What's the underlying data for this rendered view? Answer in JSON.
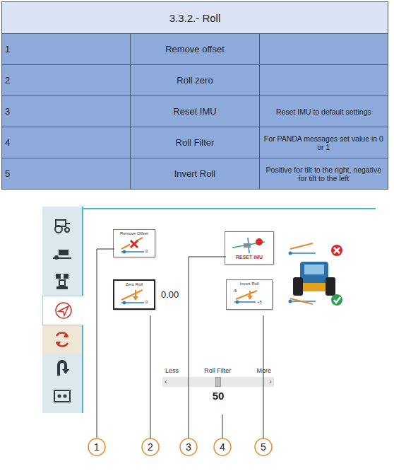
{
  "section": {
    "title": "3.3.2.- Roll"
  },
  "rows": [
    {
      "number": "1",
      "name": "Remove offset",
      "description": ""
    },
    {
      "number": "2",
      "name": "Roll zero",
      "description": ""
    },
    {
      "number": "3",
      "name": "Reset IMU",
      "description": "Reset IMU to default settings"
    },
    {
      "number": "4",
      "name": "Roll Filter",
      "description": "For PANDA messages set value in 0 or 1"
    },
    {
      "number": "5",
      "name": "Invert Roll",
      "description": "Positive for tilt to the right, negative for tilt to the left"
    }
  ],
  "screenshot": {
    "sidebar": {
      "items": [
        {
          "selected": false,
          "highlighted": false
        },
        {
          "selected": false,
          "highlighted": false
        },
        {
          "selected": false,
          "highlighted": false
        },
        {
          "selected": false,
          "highlighted": true
        },
        {
          "selected": true,
          "highlighted": false
        },
        {
          "selected": false,
          "highlighted": false
        },
        {
          "selected": false,
          "highlighted": false
        }
      ]
    },
    "remove_offset": {
      "label": "Remove Offset",
      "axis_label": "0"
    },
    "zero_roll": {
      "label": "Zero Roll",
      "axis_label": "0",
      "value": "0.00"
    },
    "reset_imu": {
      "label": "RESET IMU"
    },
    "invert_roll": {
      "label": "Invert Roll",
      "scale_left": "-5",
      "scale_right": "+5"
    },
    "roll_filter": {
      "label": "Roll Filter",
      "less": "Less",
      "more": "More",
      "left_arrow": "‹",
      "right_arrow": "›",
      "value": "50",
      "level": 0.5
    }
  },
  "callouts": [
    "1",
    "2",
    "3",
    "4",
    "5"
  ]
}
